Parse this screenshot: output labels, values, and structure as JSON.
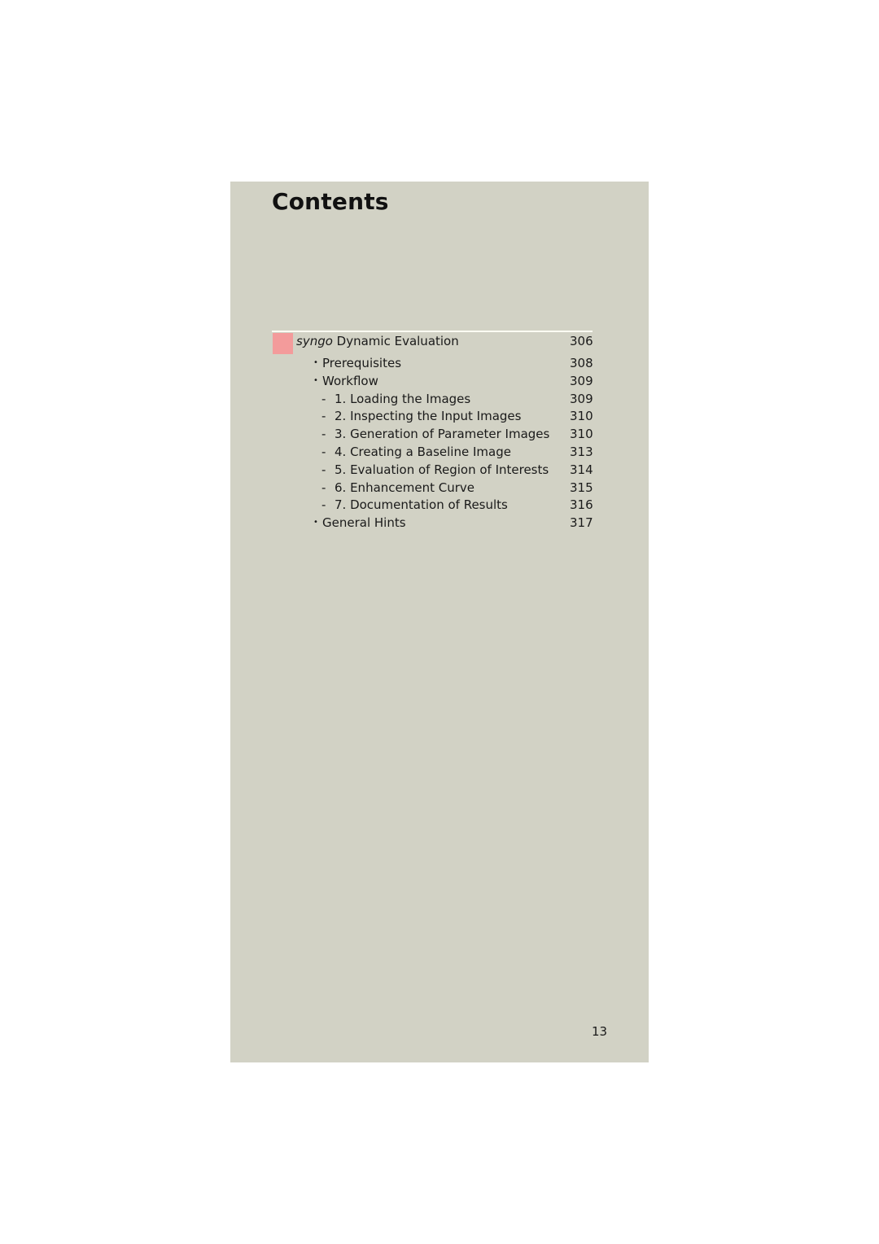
{
  "page": {
    "title": "Contents",
    "page_number": "13",
    "marker_color": "#f39b9b"
  },
  "toc": {
    "chapter": {
      "title_italic": "syngo",
      "title_rest": " Dynamic Evaluation",
      "page": "306"
    },
    "entries": [
      {
        "level": 1,
        "marker": "•",
        "label": "Prerequisites",
        "page": "308"
      },
      {
        "level": 1,
        "marker": "•",
        "label": "Workflow",
        "page": "309"
      },
      {
        "level": 2,
        "marker": "-",
        "label": "1. Loading the Images",
        "page": "309"
      },
      {
        "level": 2,
        "marker": "-",
        "label": "2. Inspecting the Input Images",
        "page": "310"
      },
      {
        "level": 2,
        "marker": "-",
        "label": "3. Generation of Parameter Images",
        "page": "310"
      },
      {
        "level": 2,
        "marker": "-",
        "label": "4. Creating a Baseline Image",
        "page": "313"
      },
      {
        "level": 2,
        "marker": "-",
        "label": "5. Evaluation of Region of Interests",
        "page": "314"
      },
      {
        "level": 2,
        "marker": "-",
        "label": "6. Enhancement Curve",
        "page": "315"
      },
      {
        "level": 2,
        "marker": "-",
        "label": "7. Documentation of Results",
        "page": "316"
      },
      {
        "level": 1,
        "marker": "•",
        "label": "General Hints",
        "page": "317"
      }
    ]
  }
}
